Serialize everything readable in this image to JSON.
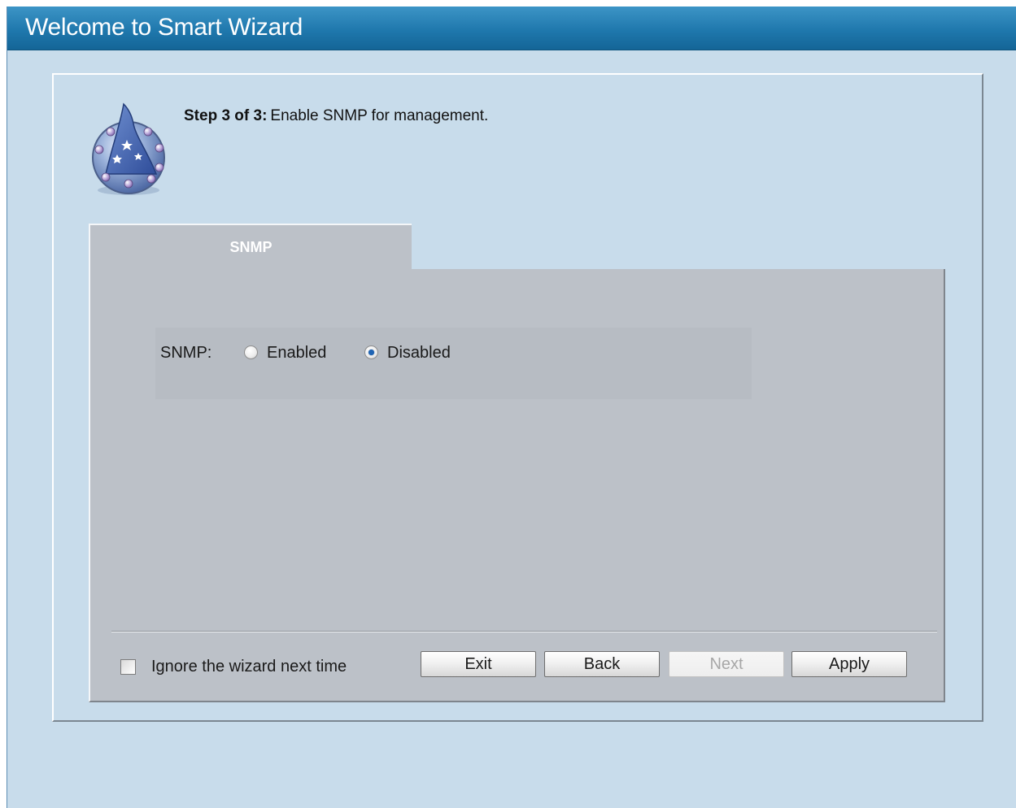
{
  "window": {
    "title": "Welcome to Smart Wizard"
  },
  "header": {
    "icon": "wizard-hat-icon",
    "step_label": "Step 3 of 3:",
    "step_description": "Enable SNMP for management."
  },
  "tab": {
    "label": "SNMP"
  },
  "snmp": {
    "label": "SNMP:",
    "options": [
      {
        "label": "Enabled",
        "selected": false
      },
      {
        "label": "Disabled",
        "selected": true
      }
    ]
  },
  "footer": {
    "ignore_label": "Ignore the wizard next time",
    "ignore_checked": false,
    "buttons": {
      "exit": "Exit",
      "back": "Back",
      "next": "Next",
      "apply": "Apply"
    },
    "next_disabled": true
  },
  "colors": {
    "title_bar": "#1f78ad",
    "background": "#c8dceb",
    "panel": "#bcc1c8",
    "radio_selected": "#1f64b4"
  }
}
